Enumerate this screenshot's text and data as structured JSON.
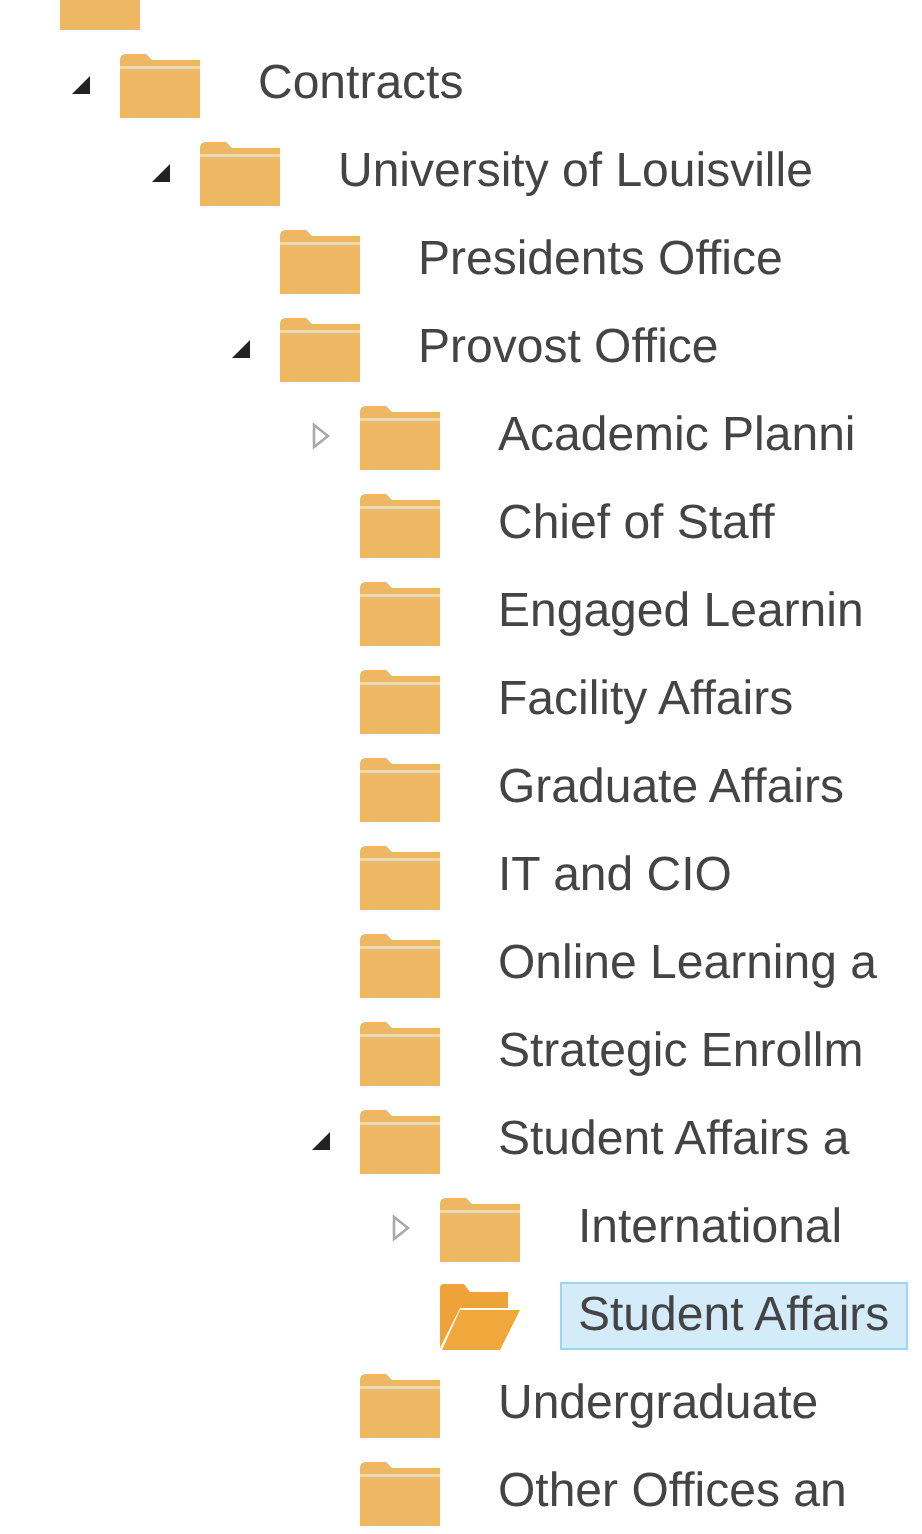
{
  "tree": {
    "children": [
      {
        "label": "Contracts",
        "expanded": true,
        "selected": false,
        "children": [
          {
            "label": "University of Louisville",
            "expanded": true,
            "selected": false,
            "children": [
              {
                "label": "Presidents Office",
                "selected": false
              },
              {
                "label": "Provost Office",
                "expanded": true,
                "selected": false,
                "children": [
                  {
                    "label": "Academic Planni",
                    "expanded": false,
                    "selected": false
                  },
                  {
                    "label": "Chief of Staff",
                    "selected": false
                  },
                  {
                    "label": "Engaged Learnin",
                    "selected": false
                  },
                  {
                    "label": "Facility Affairs",
                    "selected": false
                  },
                  {
                    "label": "Graduate Affairs",
                    "selected": false
                  },
                  {
                    "label": "IT and CIO",
                    "selected": false
                  },
                  {
                    "label": "Online Learning a",
                    "selected": false
                  },
                  {
                    "label": "Strategic Enrollm",
                    "selected": false
                  },
                  {
                    "label": "Student Affairs a",
                    "expanded": true,
                    "selected": false,
                    "children": [
                      {
                        "label": "International",
                        "expanded": false,
                        "selected": false
                      },
                      {
                        "label": "Student Affairs",
                        "selected": true
                      }
                    ]
                  },
                  {
                    "label": "Undergraduate",
                    "selected": false
                  },
                  {
                    "label": "Other Offices an",
                    "selected": false
                  }
                ]
              }
            ]
          }
        ]
      }
    ]
  }
}
